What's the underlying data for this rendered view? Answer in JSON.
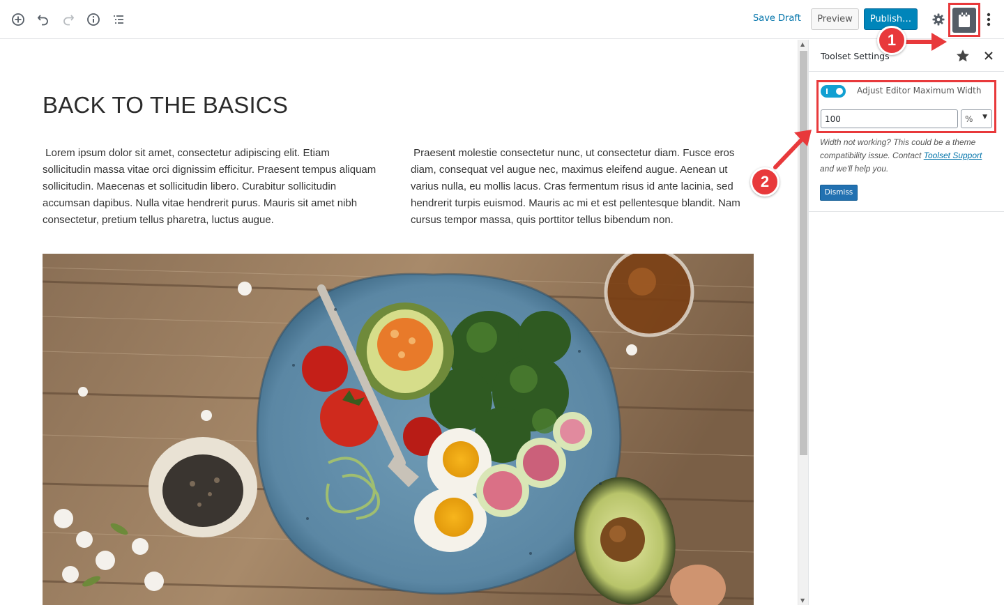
{
  "toolbar": {
    "save_draft": "Save Draft",
    "preview": "Preview",
    "publish": "Publish…",
    "icons": [
      "add-block-icon",
      "undo-icon",
      "redo-icon",
      "info-icon",
      "outline-icon",
      "gear-icon",
      "toolset-icon",
      "more-icon"
    ]
  },
  "post": {
    "title": "BACK TO THE BASICS",
    "col_left": " Lorem ipsum dolor sit amet, consectetur adipiscing elit. Etiam sollicitudin massa vitae orci dignissim efficitur. Praesent tempus aliquam sollicitudin. Maecenas et sollicitudin libero. Curabitur sollicitudin accumsan dapibus. Nulla vitae hendrerit purus. Mauris sit amet nibh consectetur, pretium tellus pharetra, luctus augue.",
    "col_right": " Praesent molestie consectetur nunc, ut consectetur diam. Fusce eros diam, consequat vel augue nec, maximus eleifend augue. Aenean ut varius nulla, eu mollis lacus. Cras fermentum risus id ante lacinia, sed hendrerit turpis euismod. Mauris ac mi et est pellentesque blandit. Nam cursus tempor massa, quis porttitor tellus bibendum non."
  },
  "sidebar": {
    "title": "Toolset Settings",
    "toggle_label": "Adjust Editor Maximum Width",
    "toggle_on": true,
    "width_value": "100",
    "unit_value": "%",
    "notice_text": "Width not working? This could be a theme compatibility issue. Contact ",
    "notice_link": "Toolset Support",
    "notice_tail": " and we'll help you.",
    "dismiss": "Dismiss"
  },
  "annotations": {
    "callout_1": "1",
    "callout_2": "2",
    "color": "#e8393b"
  },
  "colors": {
    "accent": "#0085ba",
    "link": "#0073aa",
    "toggle": "#11a0d2"
  }
}
